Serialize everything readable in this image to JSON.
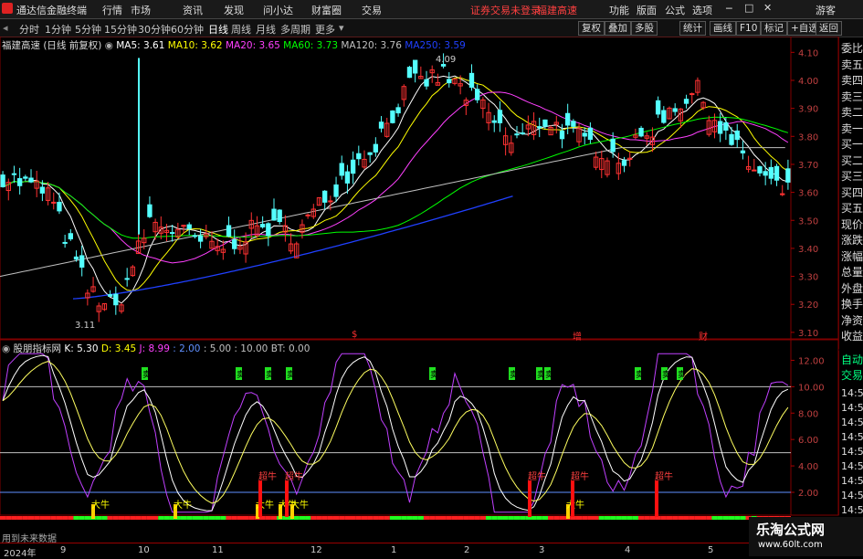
{
  "menubar": {
    "app_name": "通达信金融终端",
    "items": [
      "行情",
      "市场",
      "资讯",
      "发现",
      "问小达",
      "财富圈",
      "交易"
    ],
    "notice": "证券交易未登录",
    "stock_name": "福建高速",
    "right_items": [
      "功能",
      "版面",
      "公式",
      "选项"
    ],
    "guest": "游客"
  },
  "toolbar": {
    "periods": [
      "分时",
      "1分钟",
      "5分钟",
      "15分钟",
      "30分钟",
      "60分钟",
      "日线",
      "周线",
      "月线",
      "多周期",
      "更多"
    ],
    "active": "日线",
    "buttons": [
      "复权",
      "叠加",
      "多股",
      "统计",
      "画线",
      "F10",
      "标记",
      "+自选",
      "返回"
    ]
  },
  "price_panel": {
    "title": "福建高速 (日线 前复权)",
    "ma": [
      {
        "label": "MA5: 3.61",
        "color": "#ffffff"
      },
      {
        "label": "MA10: 3.62",
        "color": "#ffff00"
      },
      {
        "label": "MA20: 3.65",
        "color": "#ff40ff"
      },
      {
        "label": "MA60: 3.73",
        "color": "#00ff00"
      },
      {
        "label": "MA120: 3.76",
        "color": "#c0c0c0"
      },
      {
        "label": "MA250: 3.59",
        "color": "#2040ff"
      }
    ],
    "yticks": [
      "4.10",
      "4.00",
      "3.90",
      "3.80",
      "3.70",
      "3.60",
      "3.50",
      "3.40",
      "3.30",
      "3.20",
      "3.10"
    ],
    "high_label": "4.09",
    "low_label": "3.11",
    "event_marks": [
      "$",
      "增",
      "财"
    ]
  },
  "indicator_panel": {
    "title": "股朋指标网",
    "params": [
      {
        "label": "K: 5.30",
        "color": "#ffffff"
      },
      {
        "label": "D: 3.45",
        "color": "#ffff00"
      },
      {
        "label": "J: 8.99",
        "color": "#ff40ff"
      },
      {
        "label": ": 2.00",
        "color": "#6090ff"
      },
      {
        "label": ": 5.00",
        "color": "#c0c0c0"
      },
      {
        "label": ": 10.00",
        "color": "#c0c0c0"
      },
      {
        "label": "BT: 0.00",
        "color": "#c0c0c0"
      }
    ],
    "yticks": [
      "12.00",
      "10.00",
      "8.00",
      "6.00",
      "4.00",
      "2.00"
    ],
    "sell_label": "卖",
    "big_bull_label": "大牛",
    "super_bull_label": "超牛"
  },
  "side_panel": {
    "items": [
      "委比",
      "卖五",
      "卖四",
      "卖三",
      "卖二",
      "卖一",
      "买一",
      "买二",
      "买三",
      "买四",
      "买五",
      "现价",
      "涨跌",
      "涨幅",
      "总量",
      "外盘",
      "换手",
      "净资",
      "收益"
    ],
    "lower_items": [
      "自动",
      "交易"
    ],
    "times": [
      "14:56",
      "14:56",
      "14:56",
      "14:56",
      "14:56",
      "14:56",
      "14:56",
      "14:56",
      "14:56",
      "14:56"
    ]
  },
  "bottom": {
    "no_data": "用到未来数据",
    "time_labels": [
      "2024年",
      "9",
      "10",
      "11",
      "12",
      "1",
      "2",
      "3",
      "4",
      "5"
    ]
  },
  "watermark": {
    "title": "乐淘公式网",
    "url": "www.60lt.com"
  }
}
